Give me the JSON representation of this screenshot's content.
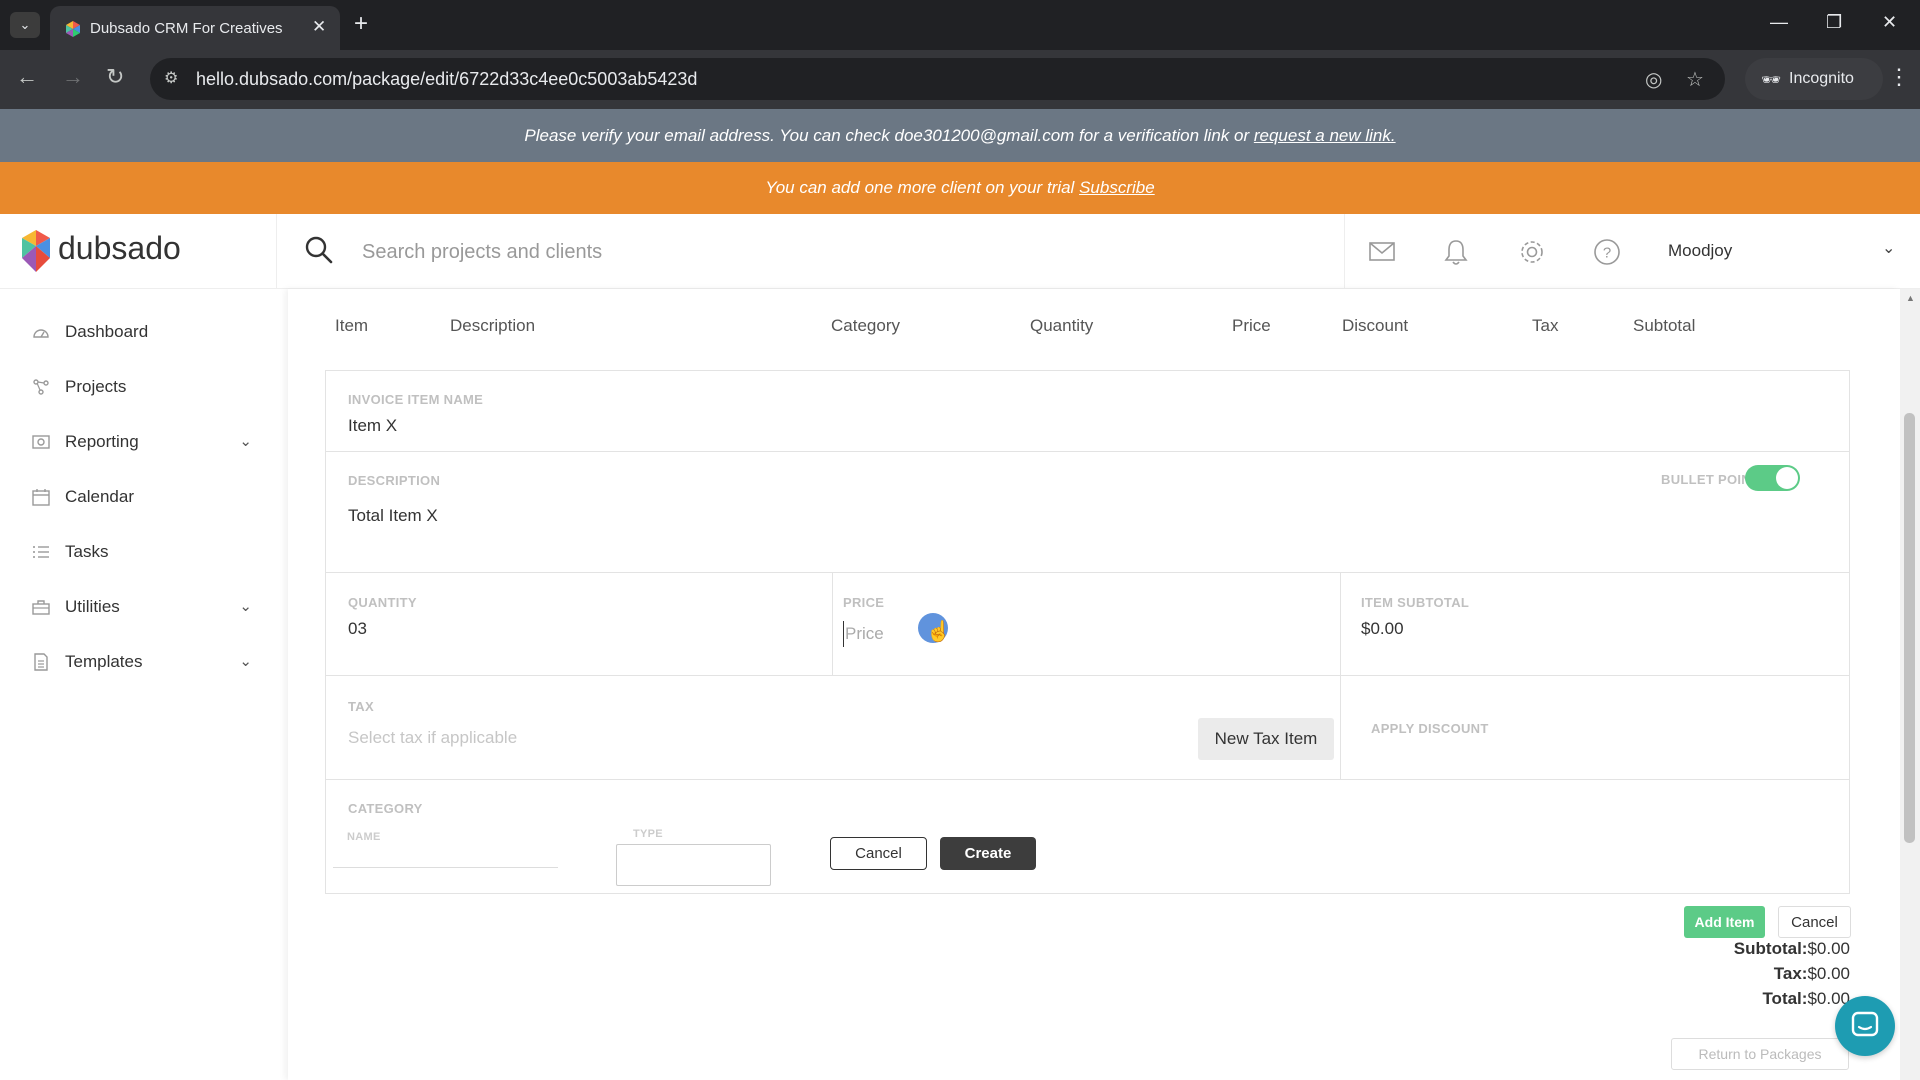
{
  "browser": {
    "tab_title": "Dubsado CRM For Creatives",
    "url": "hello.dubsado.com/package/edit/6722d33c4ee0c5003ab5423d",
    "incognito_label": "Incognito"
  },
  "banners": {
    "verify_text": "Please verify your email address. You can check doe301200@gmail.com for a verification link or",
    "verify_link": "request a new link.",
    "trial_text": "You can add one more client on your trial",
    "trial_link": "Subscribe"
  },
  "header": {
    "logo_text": "dubsado",
    "search_placeholder": "Search projects and clients",
    "user_name": "Moodjoy"
  },
  "sidebar": {
    "items": [
      {
        "label": "Dashboard",
        "icon": "dashboard-icon",
        "has_chevron": false
      },
      {
        "label": "Projects",
        "icon": "projects-icon",
        "has_chevron": false
      },
      {
        "label": "Reporting",
        "icon": "reporting-icon",
        "has_chevron": true
      },
      {
        "label": "Calendar",
        "icon": "calendar-icon",
        "has_chevron": false
      },
      {
        "label": "Tasks",
        "icon": "tasks-icon",
        "has_chevron": false
      },
      {
        "label": "Utilities",
        "icon": "utilities-icon",
        "has_chevron": true
      },
      {
        "label": "Templates",
        "icon": "templates-icon",
        "has_chevron": true
      }
    ]
  },
  "table": {
    "columns": [
      "Item",
      "Description",
      "Category",
      "Quantity",
      "Price",
      "Discount",
      "Tax",
      "Subtotal"
    ]
  },
  "form": {
    "item_name_label": "INVOICE ITEM NAME",
    "item_name_value": "Item X",
    "description_label": "DESCRIPTION",
    "description_value": "Total Item X",
    "bullet_points_label": "BULLET POINTS",
    "bullet_points_on": true,
    "quantity_label": "QUANTITY",
    "quantity_value": "03",
    "price_label": "PRICE",
    "price_placeholder": "Price",
    "item_subtotal_label": "ITEM SUBTOTAL",
    "item_subtotal_value": "$0.00",
    "tax_label": "TAX",
    "tax_placeholder": "Select tax if applicable",
    "new_tax_button": "New Tax Item",
    "apply_discount_label": "APPLY DISCOUNT",
    "category_label": "CATEGORY",
    "category_name_label": "NAME",
    "category_type_label": "TYPE",
    "category_cancel": "Cancel",
    "category_create": "Create"
  },
  "actions": {
    "add_item": "Add Item",
    "cancel": "Cancel",
    "return_to_packages": "Return to Packages"
  },
  "totals": {
    "subtotal_label": "Subtotal:",
    "subtotal_value": "$0.00",
    "tax_label": "Tax:",
    "tax_value": "$0.00",
    "total_label": "Total:",
    "total_value": "$0.00"
  },
  "colors": {
    "accent_green": "#5ccb87",
    "trial_orange": "#e8892c",
    "verify_gray": "#6b7784"
  }
}
